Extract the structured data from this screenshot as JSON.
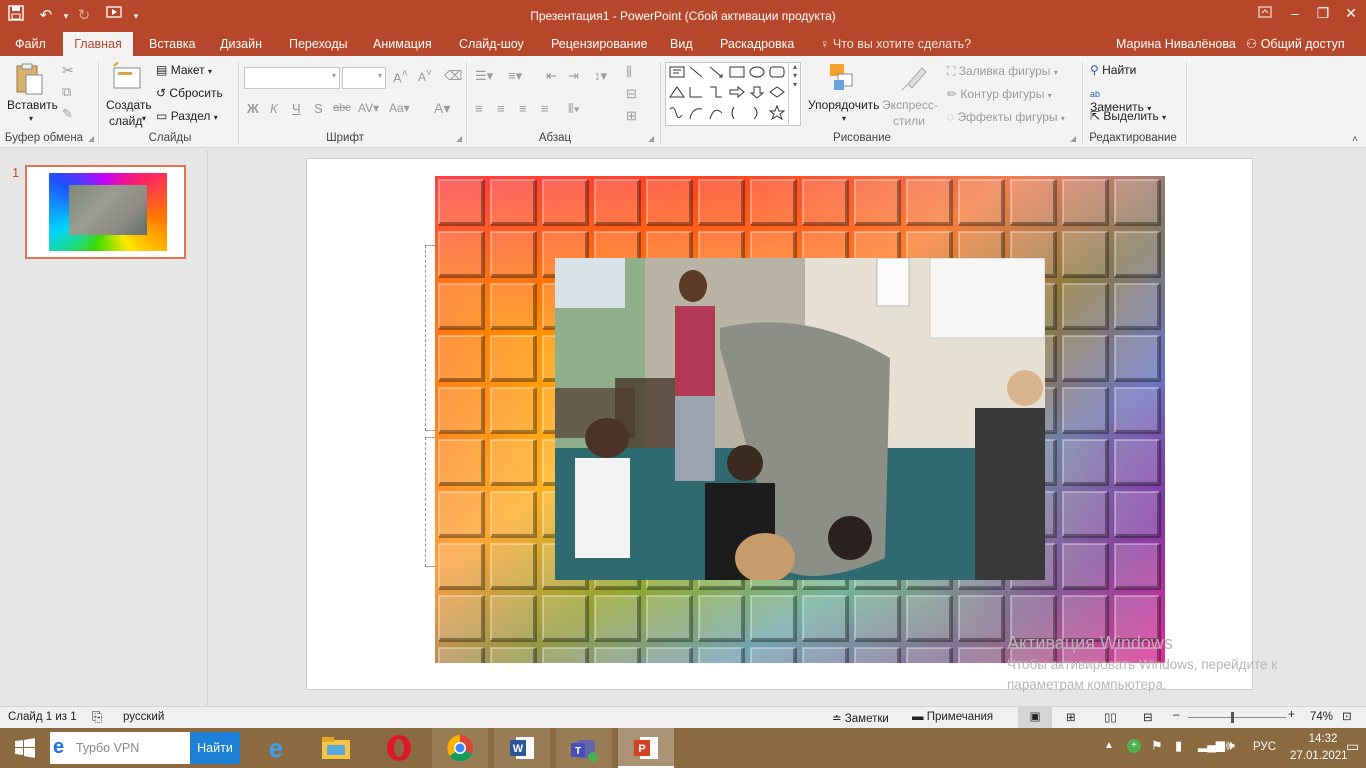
{
  "window": {
    "title": "Презентация1 - PowerPoint (Сбой активации продукта)"
  },
  "tabs": [
    "Файл",
    "Главная",
    "Вставка",
    "Дизайн",
    "Переходы",
    "Анимация",
    "Слайд-шоу",
    "Рецензирование",
    "Вид",
    "Раскадровка"
  ],
  "tell_me": "Что вы хотите сделать?",
  "user": "Марина Нивалёнова",
  "share": "Общий доступ",
  "ribbon": {
    "paste": "Вставить",
    "new_slide_1": "Создать",
    "new_slide_2": "слайд",
    "layout": "Макет",
    "reset": "Сбросить",
    "section": "Раздел",
    "arrange": "Упорядочить",
    "quick_styles_1": "Экспресс-",
    "quick_styles_2": "стили",
    "shape_fill": "Заливка фигуры",
    "shape_outline": "Контур фигуры",
    "shape_effects": "Эффекты фигуры",
    "find": "Найти",
    "replace": "Заменить",
    "select": "Выделить",
    "groups": [
      "Буфер обмена",
      "Слайды",
      "Шрифт",
      "Абзац",
      "Рисование",
      "Редактирование"
    ]
  },
  "thumbnail_number": "1",
  "watermark": {
    "line1": "Активация Windows",
    "line2": "Чтобы активировать Windows, перейдите к",
    "line3": "параметрам компьютера."
  },
  "status": {
    "slide": "Слайд 1 из 1",
    "language": "русский",
    "notes": "Заметки",
    "comments": "Примечания",
    "zoom": "74%",
    "zoom_level": 0.45
  },
  "taskbar": {
    "search_placeholder": "Турбо VPN",
    "search_button": "Найти",
    "language": "РУС",
    "time": "14:32",
    "date": "27.01.2021"
  },
  "colors": {
    "accent": "#b7472a",
    "taskbar": "#8a6a3e"
  }
}
